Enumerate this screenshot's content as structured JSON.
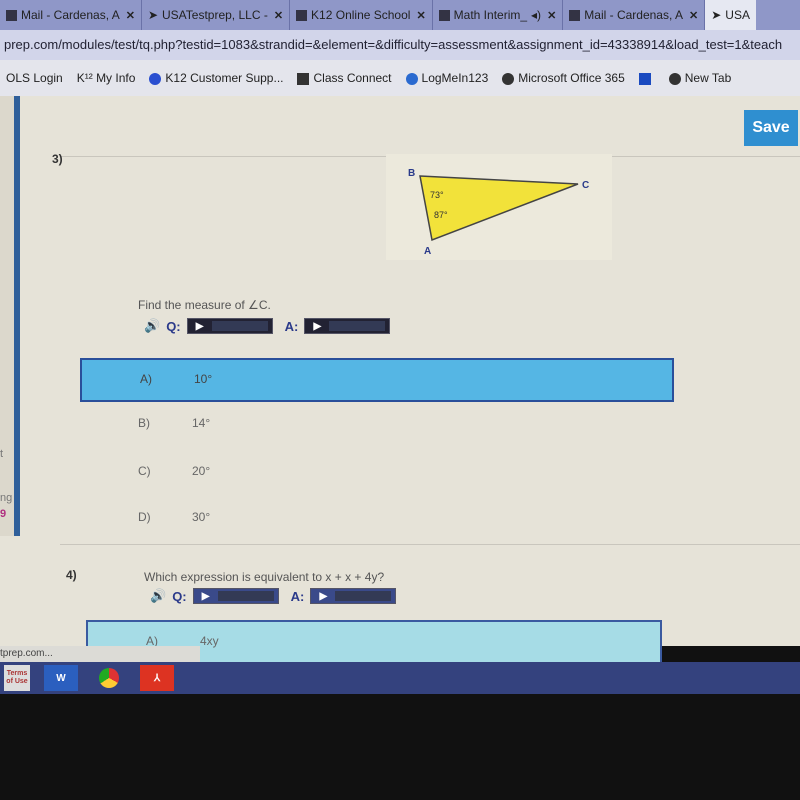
{
  "browser": {
    "tabs": [
      {
        "label": "Mail - Cardenas, A"
      },
      {
        "label": "USATestprep, LLC -"
      },
      {
        "label": "K12 Online School"
      },
      {
        "label": "Math Interim_"
      },
      {
        "label": "Mail - Cardenas, A"
      },
      {
        "label": "USA"
      }
    ],
    "address": "prep.com/modules/test/tq.php?testid=1083&strandid=&element=&difficulty=assessment&assignment_id=43338914&load_test=1&teach",
    "bookmarks": [
      {
        "label": "OLS Login"
      },
      {
        "label": "My Info"
      },
      {
        "label": "K12 Customer Supp..."
      },
      {
        "label": "Class Connect"
      },
      {
        "label": "LogMeIn123"
      },
      {
        "label": "Microsoft Office 365"
      },
      {
        "label": ""
      },
      {
        "label": "New Tab"
      }
    ]
  },
  "toolbar": {
    "save_label": "Save"
  },
  "side": {
    "t1": "t",
    "t2": "ng",
    "t3": "9"
  },
  "questions": [
    {
      "number": "3)",
      "text": "Find the measure of ∠C.",
      "figure": {
        "vertices": [
          "B",
          "C",
          "A"
        ],
        "angles": [
          "73°",
          "87°"
        ]
      },
      "q_label": "Q:",
      "a_label": "A:",
      "choices": [
        {
          "letter": "A)",
          "value": "10°",
          "selected": true
        },
        {
          "letter": "B)",
          "value": "14°"
        },
        {
          "letter": "C)",
          "value": "20°"
        },
        {
          "letter": "D)",
          "value": "30°"
        }
      ]
    },
    {
      "number": "4)",
      "text": "Which expression is equivalent to x + x + 4y?",
      "q_label": "Q:",
      "a_label": "A:",
      "choices": [
        {
          "letter": "A)",
          "value": "4xy"
        }
      ]
    }
  ],
  "status_url": "tprep.com...",
  "taskbar": {
    "items": [
      "Terms of Use",
      "Word",
      "Chrome",
      "Acrobat"
    ]
  },
  "colors": {
    "selected_choice": "#55b6e4",
    "save": "#2f8fd0",
    "taskbar": "#34427e"
  }
}
